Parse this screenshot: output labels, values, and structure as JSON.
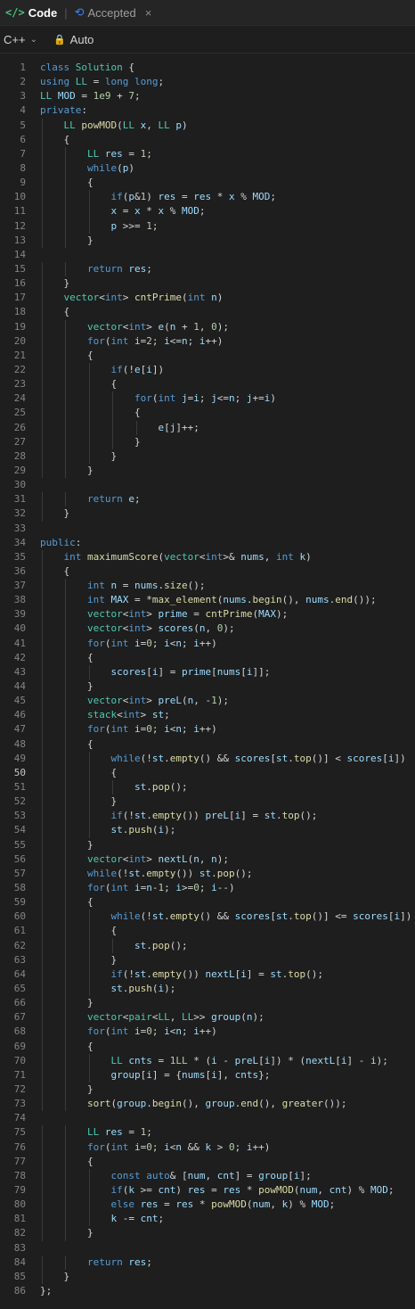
{
  "tabs": {
    "code_icon": "</>",
    "code_label": "Code",
    "accepted_label": "Accepted",
    "close_glyph": "×"
  },
  "toolbar": {
    "language": "C++",
    "mode": "Auto"
  },
  "editor": {
    "active_line": 50,
    "lines": [
      "class Solution {",
      "using LL = long long;",
      "LL MOD = 1e9 + 7;",
      "private:",
      "    LL powMOD(LL x, LL p)",
      "    {",
      "        LL res = 1;",
      "        while(p)",
      "        {",
      "            if(p&1) res = res * x % MOD;",
      "            x = x * x % MOD;",
      "            p >>= 1;",
      "        }",
      "",
      "        return res;",
      "    }",
      "    vector<int> cntPrime(int n)",
      "    {",
      "        vector<int> e(n + 1, 0);",
      "        for(int i=2; i<=n; i++)",
      "        {",
      "            if(!e[i])",
      "            {",
      "                for(int j=i; j<=n; j+=i)",
      "                {",
      "                    e[j]++;",
      "                }",
      "            }",
      "        }",
      "",
      "        return e;",
      "    }",
      "",
      "public:",
      "    int maximumScore(vector<int>& nums, int k)",
      "    {",
      "        int n = nums.size();",
      "        int MAX = *max_element(nums.begin(), nums.end());",
      "        vector<int> prime = cntPrime(MAX);",
      "        vector<int> scores(n, 0);",
      "        for(int i=0; i<n; i++)",
      "        {",
      "            scores[i] = prime[nums[i]];",
      "        }",
      "        vector<int> preL(n, -1);",
      "        stack<int> st;",
      "        for(int i=0; i<n; i++)",
      "        {",
      "            while(!st.empty() && scores[st.top()] < scores[i])",
      "            {",
      "                st.pop();",
      "            }",
      "            if(!st.empty()) preL[i] = st.top();",
      "            st.push(i);",
      "        }",
      "        vector<int> nextL(n, n);",
      "        while(!st.empty()) st.pop();",
      "        for(int i=n-1; i>=0; i--)",
      "        {",
      "            while(!st.empty() && scores[st.top()] <= scores[i])",
      "            {",
      "                st.pop();",
      "            }",
      "            if(!st.empty()) nextL[i] = st.top();",
      "            st.push(i);",
      "        }",
      "        vector<pair<LL, LL>> group(n);",
      "        for(int i=0; i<n; i++)",
      "        {",
      "            LL cnts = 1LL * (i - preL[i]) * (nextL[i] - i);",
      "            group[i] = {nums[i], cnts};",
      "        }",
      "        sort(group.begin(), group.end(), greater());",
      "",
      "        LL res = 1;",
      "        for(int i=0; i<n && k > 0; i++)",
      "        {",
      "            const auto& [num, cnt] = group[i];",
      "            if(k >= cnt) res = res * powMOD(num, cnt) % MOD;",
      "            else res = res * powMOD(num, k) % MOD;",
      "            k -= cnt;",
      "        }",
      "",
      "        return res;",
      "    }",
      "};"
    ]
  }
}
